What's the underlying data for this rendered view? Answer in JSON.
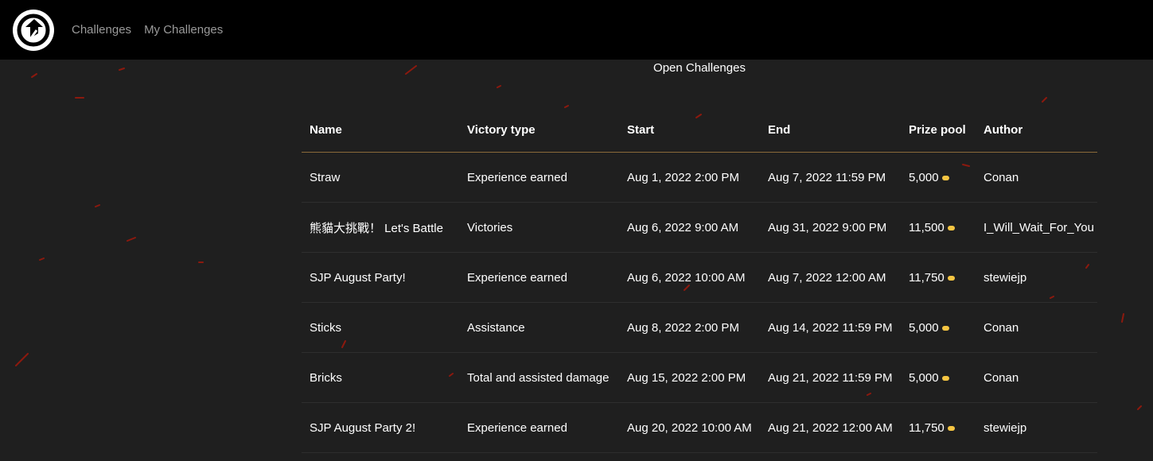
{
  "nav": {
    "logo": "logo-icon",
    "links": [
      "Challenges",
      "My Challenges"
    ]
  },
  "heading": "Open Challenges",
  "table": {
    "headers": [
      "Name",
      "Victory type",
      "Start",
      "End",
      "Prize pool",
      "Author"
    ],
    "rows": [
      {
        "name": "Straw",
        "victory_type": "Experience earned",
        "start": "Aug 1, 2022 2:00 PM",
        "end": "Aug 7, 2022 11:59 PM",
        "prize": "5,000",
        "author": "Conan"
      },
      {
        "name": "熊貓大挑戰！ Let's Battle",
        "victory_type": "Victories",
        "start": "Aug 6, 2022 9:00 AM",
        "end": "Aug 31, 2022 9:00 PM",
        "prize": "11,500",
        "author": "I_Will_Wait_For_You"
      },
      {
        "name": "SJP August Party!",
        "victory_type": "Experience earned",
        "start": "Aug 6, 2022 10:00 AM",
        "end": "Aug 7, 2022 12:00 AM",
        "prize": "11,750",
        "author": "stewiejp"
      },
      {
        "name": "Sticks",
        "victory_type": "Assistance",
        "start": "Aug 8, 2022 2:00 PM",
        "end": "Aug 14, 2022 11:59 PM",
        "prize": "5,000",
        "author": "Conan"
      },
      {
        "name": "Bricks",
        "victory_type": "Total and assisted damage",
        "start": "Aug 15, 2022 2:00 PM",
        "end": "Aug 21, 2022 11:59 PM",
        "prize": "5,000",
        "author": "Conan"
      },
      {
        "name": "SJP August Party 2!",
        "victory_type": "Experience earned",
        "start": "Aug 20, 2022 10:00 AM",
        "end": "Aug 21, 2022 12:00 AM",
        "prize": "11,750",
        "author": "stewiejp"
      }
    ]
  },
  "colors": {
    "topbar": "#000000",
    "background": "#1f1f1f",
    "prize": "#f5a623",
    "header_border": "#8a6a3a"
  }
}
